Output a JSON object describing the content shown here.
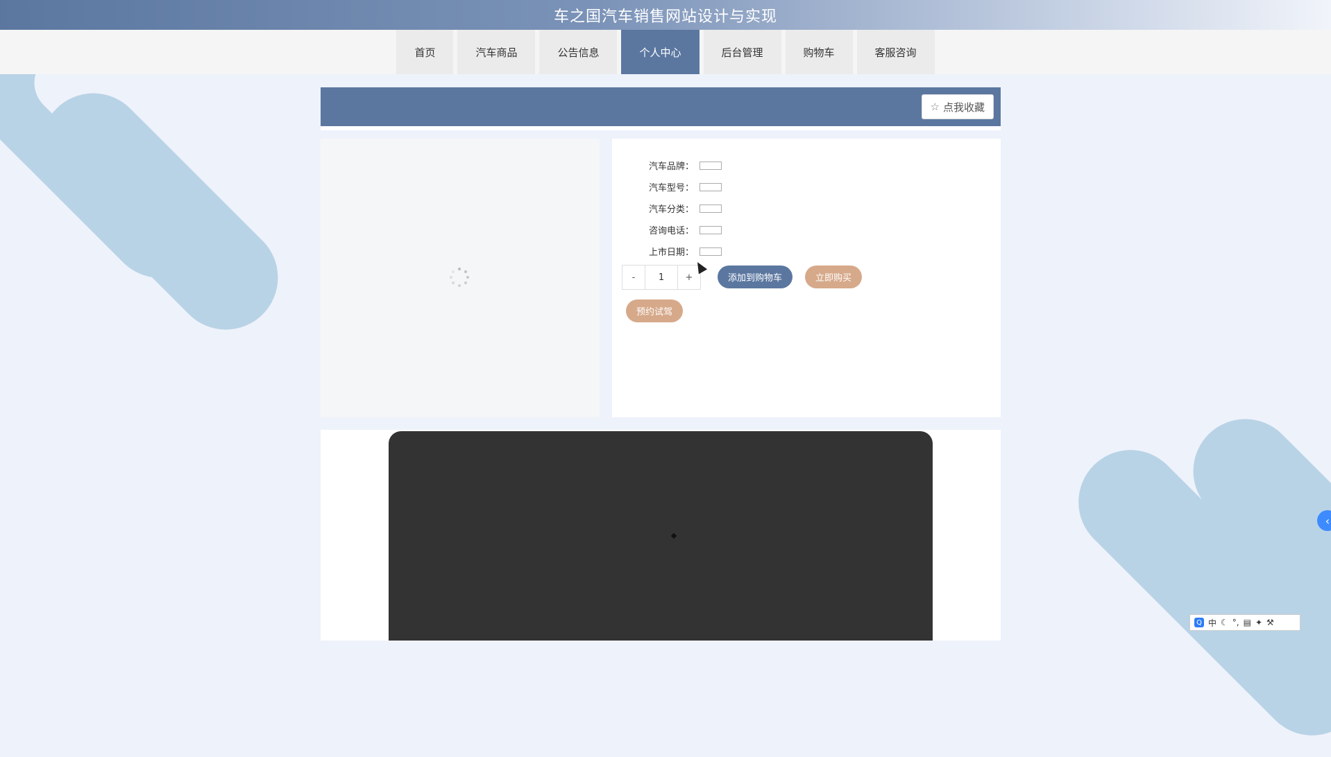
{
  "header": {
    "title": "车之国汽车销售网站设计与实现"
  },
  "nav": {
    "items": [
      {
        "label": "首页"
      },
      {
        "label": "汽车商品"
      },
      {
        "label": "公告信息"
      },
      {
        "label": "个人中心"
      },
      {
        "label": "后台管理"
      },
      {
        "label": "购物车"
      },
      {
        "label": "客服咨询"
      }
    ],
    "active": "个人中心"
  },
  "panel": {
    "favorite_label": "点我收藏",
    "favorite_icon": "star-outline-icon"
  },
  "details": {
    "brand_label": "汽车品牌：",
    "model_label": "汽车型号：",
    "category_label": "汽车分类：",
    "phone_label": "咨询电话：",
    "release_label": "上市日期："
  },
  "quantity": {
    "minus": "-",
    "value": "1",
    "plus": "+"
  },
  "actions": {
    "add_to_cart": "添加到购物车",
    "buy_now": "立即购买",
    "test_drive": "预约试驾"
  },
  "ime": {
    "logo": "Q",
    "mode": "中"
  },
  "colors": {
    "primary": "#5b77a0",
    "accent": "#d6a98a",
    "page_bg": "#eef2fb"
  }
}
